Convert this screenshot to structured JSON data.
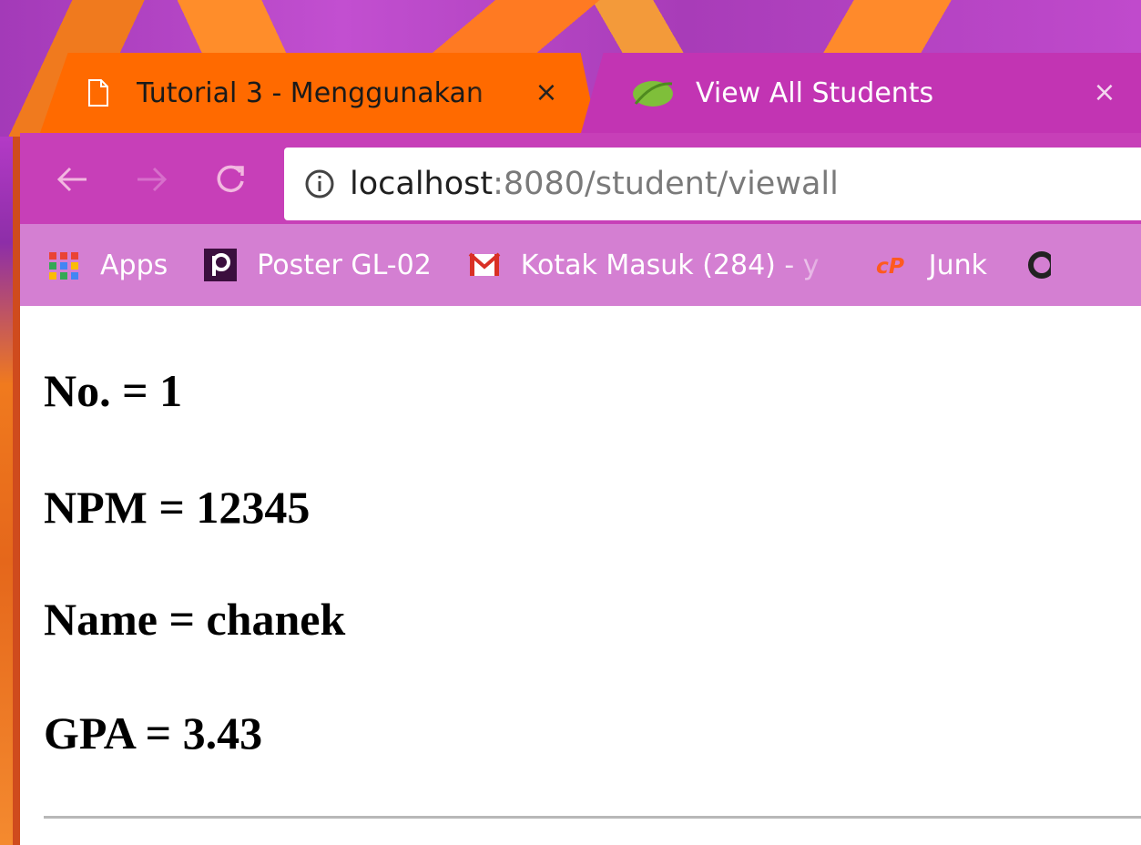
{
  "tabs": [
    {
      "title": "Tutorial 3 - Menggunakan",
      "close": "×",
      "active": false
    },
    {
      "title": "View All Students",
      "close": "×",
      "active": true
    }
  ],
  "toolbar": {
    "url_host": "localhost",
    "url_path": ":8080/student/viewall"
  },
  "bookmarks": [
    {
      "label": "Apps",
      "icon": "apps-grid-icon"
    },
    {
      "label": "Poster GL-02",
      "icon": "p-logo-icon"
    },
    {
      "label": "Kotak Masuk (284) - y",
      "icon": "gmail-icon"
    },
    {
      "label": "Junk",
      "icon": "cpanel-icon"
    }
  ],
  "student": {
    "no": "No. = 1",
    "npm": "NPM = 12345",
    "name": "Name = chanek",
    "gpa": "GPA = 3.43"
  },
  "colors": {
    "tab_inactive": "#ff6a00",
    "tab_active": "#c234b3",
    "toolbar": "#c73fb8",
    "bookmarks_bar": "#d47fd2"
  }
}
